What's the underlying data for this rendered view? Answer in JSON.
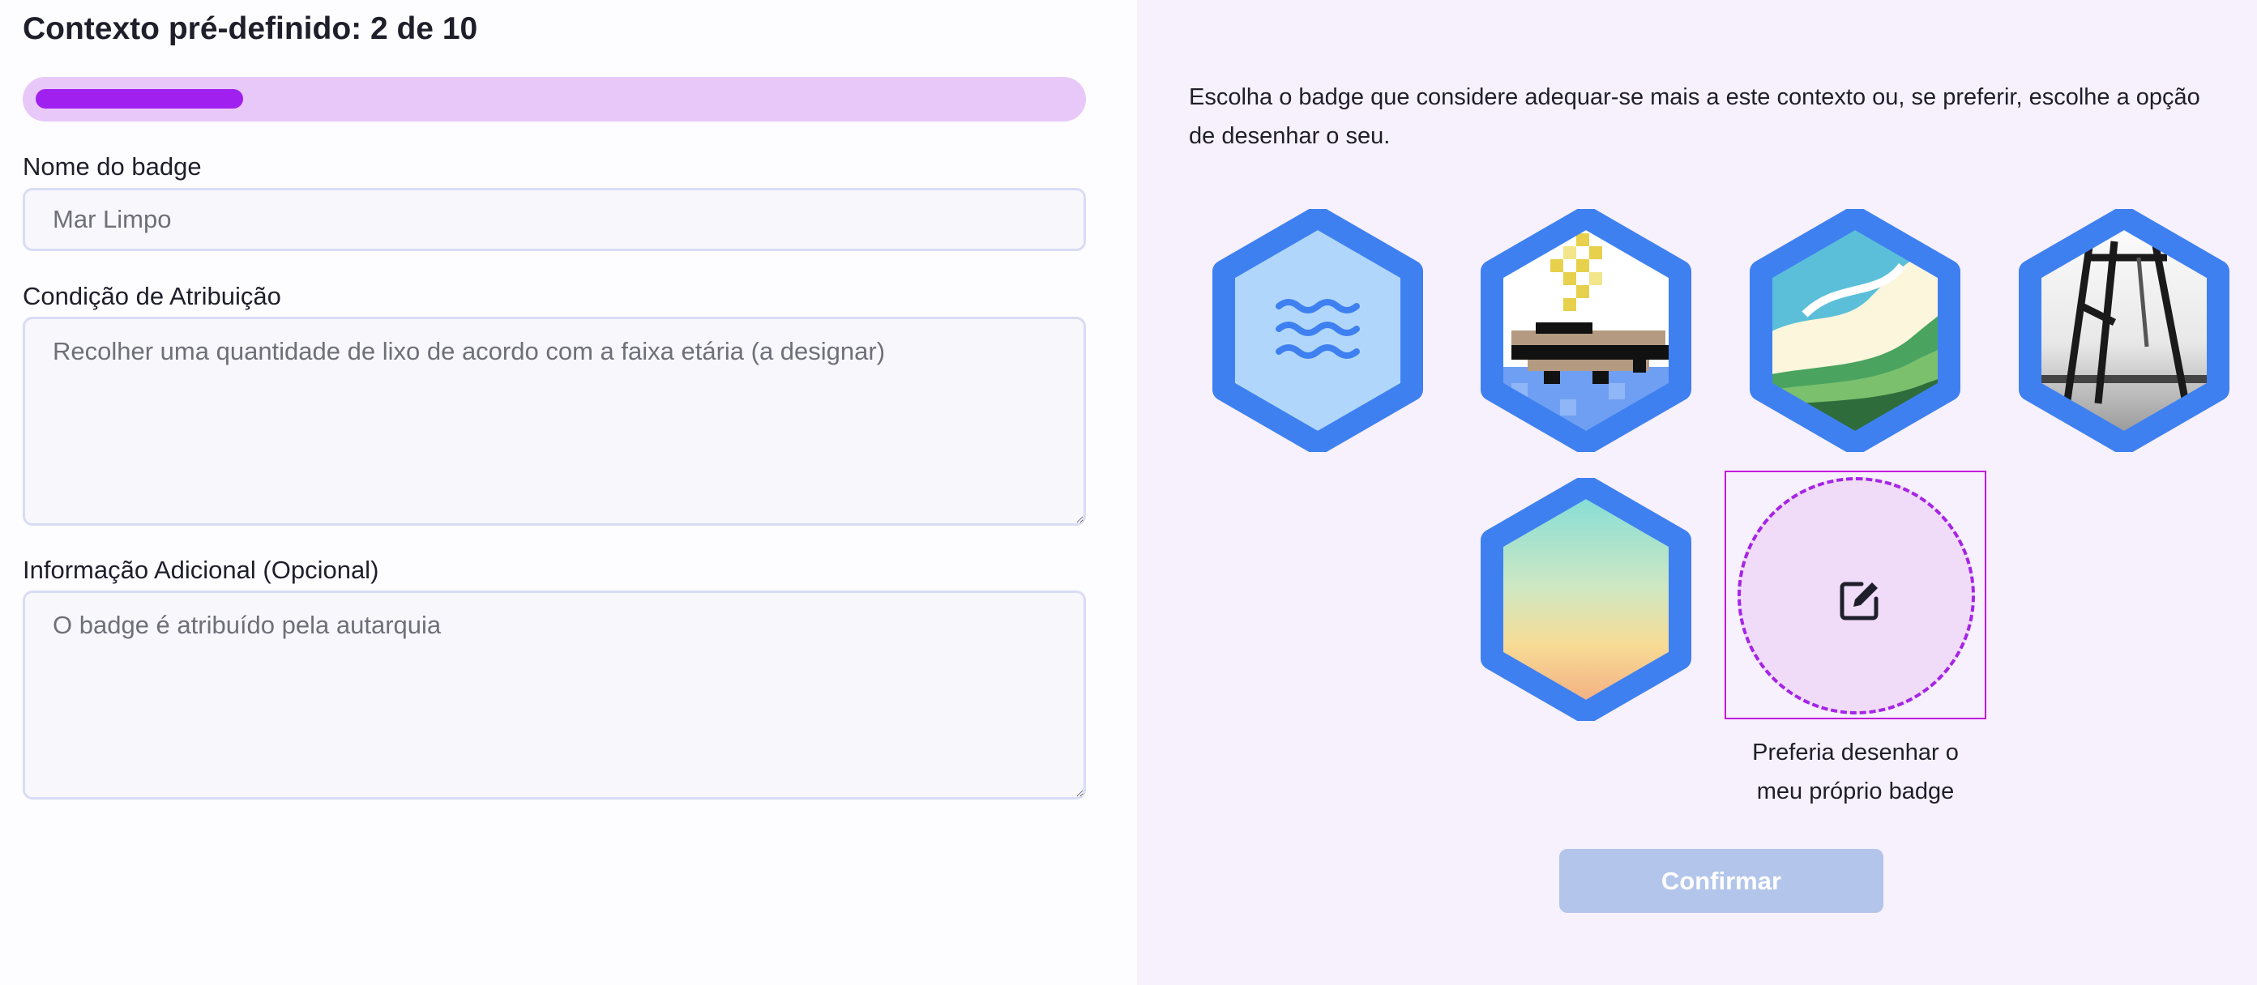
{
  "form": {
    "title": "Contexto pré-definido: 2 de 10",
    "progress": {
      "current": 2,
      "total": 10,
      "fraction": 0.2
    },
    "badge_name": {
      "label": "Nome do badge",
      "placeholder": "Mar Limpo"
    },
    "condition": {
      "label": "Condição de Atribuição",
      "placeholder": "Recolher uma quantidade de lixo de acordo com a faixa etária (a designar)"
    },
    "additional_info": {
      "label": "Informação Adicional (Opcional)",
      "placeholder": "O badge é atribuído pela autarquia"
    }
  },
  "chooser": {
    "instructions": "Escolha o badge que considere adequar-se mais a este contexto ou, se preferir, escolhe a opção de desenhar o seu.",
    "badges": [
      {
        "id": "waves",
        "icon": "waves-icon"
      },
      {
        "id": "pixel-boat",
        "icon": "pixel-boat-image"
      },
      {
        "id": "abstract-sea",
        "icon": "abstract-waves-image"
      },
      {
        "id": "pier-photo",
        "icon": "pier-photo-image"
      },
      {
        "id": "sunset-gradient",
        "icon": "gradient-image"
      }
    ],
    "draw_option": {
      "icon": "edit-icon",
      "caption_line1": "Preferia desenhar o",
      "caption_line2": "meu próprio badge"
    },
    "confirm_label": "Confirmar"
  },
  "colors": {
    "accent_purple": "#a020ef",
    "progress_track": "#e8c8f9",
    "hex_border_blue": "#3f80f1",
    "confirm_disabled": "#b3c5ea",
    "right_panel_bg": "#f7f1fd"
  }
}
